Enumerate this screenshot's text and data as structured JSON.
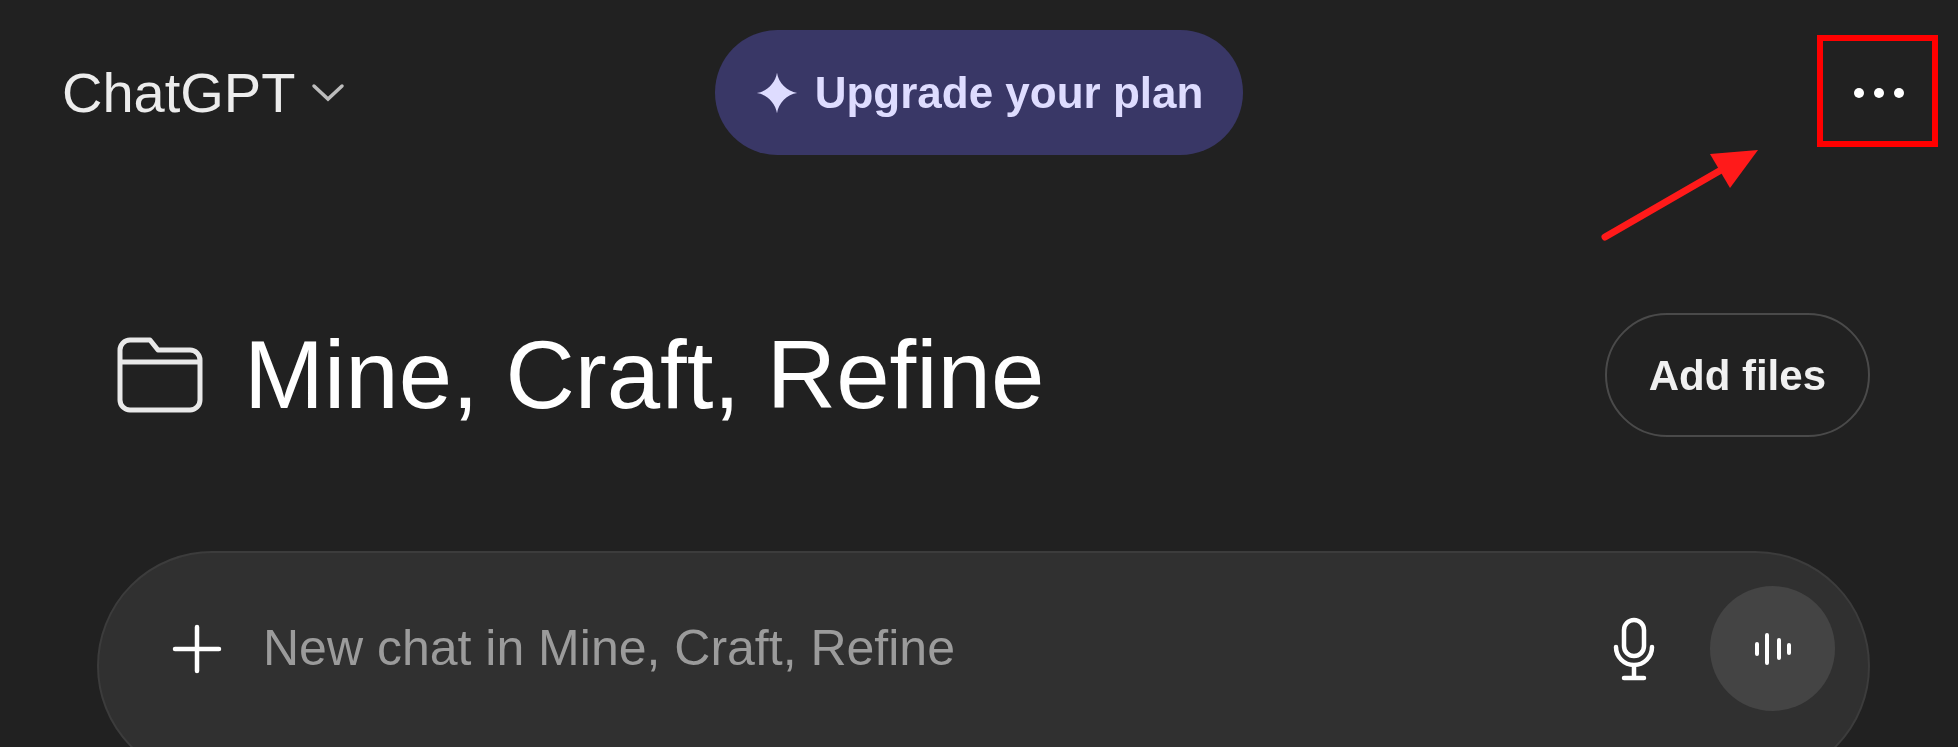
{
  "header": {
    "title": "ChatGPT",
    "upgrade_button": "Upgrade your plan"
  },
  "annotations": {
    "highlight_box": true,
    "pointer_arrow": true
  },
  "project": {
    "title": "Mine, Craft, Refine",
    "add_files_button": "Add files"
  },
  "composer": {
    "placeholder": "New chat in Mine, Craft, Refine"
  }
}
